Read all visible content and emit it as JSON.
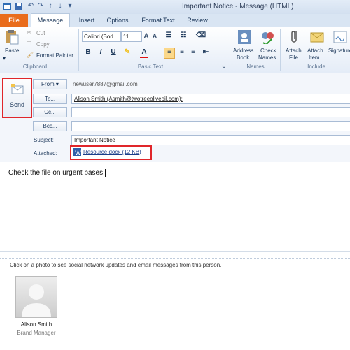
{
  "window": {
    "title": "Important Notice  -  Message (HTML)"
  },
  "quick_access": {
    "save_icon": "save-icon",
    "undo_icon": "undo-icon",
    "redo_icon": "redo-icon"
  },
  "tabs": [
    {
      "label": "File"
    },
    {
      "label": "Message"
    },
    {
      "label": "Insert"
    },
    {
      "label": "Options"
    },
    {
      "label": "Format Text"
    },
    {
      "label": "Review"
    }
  ],
  "ribbon": {
    "clipboard": {
      "paste": "Paste",
      "cut": "Cut",
      "copy": "Copy",
      "format_painter": "Format Painter",
      "group_label": "Clipboard"
    },
    "basic_text": {
      "font": "Calibri (Bod",
      "size": "11",
      "bold": "B",
      "italic": "I",
      "underline": "U",
      "font_color": "A",
      "group_label": "Basic Text"
    },
    "names": {
      "address_book_line1": "Address",
      "address_book_line2": "Book",
      "check_names_line1": "Check",
      "check_names_line2": "Names",
      "group_label": "Names"
    },
    "include": {
      "attach_file_line1": "Attach",
      "attach_file_line2": "File",
      "attach_item_line1": "Attach",
      "attach_item_line2": "Item",
      "signature": "Signature",
      "group_label": "Include"
    }
  },
  "compose": {
    "send": "Send",
    "from_button": "From",
    "from_value": "newuser7887@gmail.com",
    "to_button": "To...",
    "to_value": "Alison Smith (Asmith@twotreeoliveoil.com);",
    "cc_button": "Cc...",
    "cc_value": "",
    "bcc_button": "Bcc...",
    "bcc_value": "",
    "subject_label": "Subject:",
    "subject_value": "Important Notice",
    "attached_label": "Attached:",
    "attachment": "Resource.docx (12 KB)"
  },
  "body": {
    "text": "Check the file on urgent bases"
  },
  "people_pane": {
    "hint": "Click on a photo to see social network updates and email messages from this person.",
    "person_name": "Alison Smith",
    "person_title": "Brand Manager"
  },
  "colors": {
    "file_tab": "#e96c1c",
    "highlight": "#e0262a",
    "ribbon_text": "#1e395b"
  }
}
